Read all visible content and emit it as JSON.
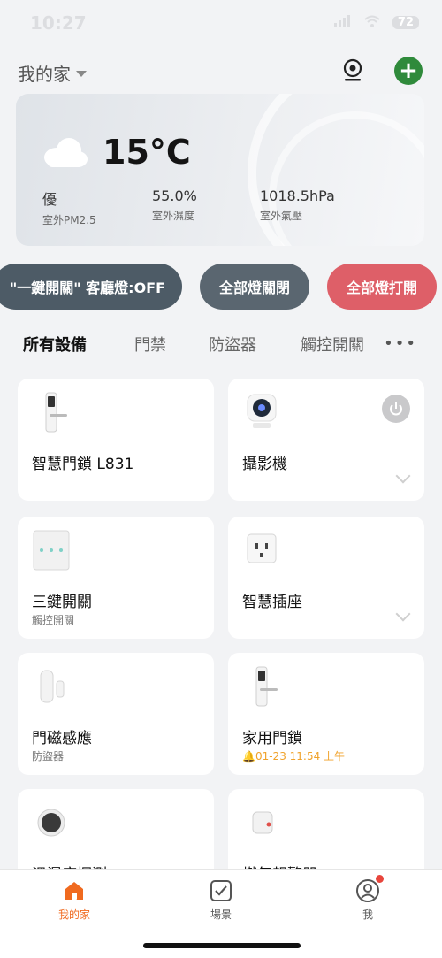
{
  "status_bar": {
    "time": "10:27",
    "battery": "72"
  },
  "header": {
    "home_name": "我的家"
  },
  "weather": {
    "temperature": "15°C",
    "stats": [
      {
        "value": "優",
        "label": "室外PM2.5"
      },
      {
        "value": "55.0%",
        "label": "室外濕度"
      },
      {
        "value": "1018.5hPa",
        "label": "室外氣壓"
      }
    ]
  },
  "scenes": [
    {
      "label": "\"一鍵開關\" 客廳燈:OFF"
    },
    {
      "label": "全部燈關閉"
    },
    {
      "label": "全部燈打開"
    }
  ],
  "tabs": [
    "所有設備",
    "門禁",
    "防盜器",
    "觸控開關"
  ],
  "devices": [
    {
      "name": "智慧門鎖 L831",
      "subtitle": ""
    },
    {
      "name": "攝影機",
      "subtitle": ""
    },
    {
      "name": "三鍵開關",
      "subtitle": "觸控開關"
    },
    {
      "name": "智慧插座",
      "subtitle": ""
    },
    {
      "name": "門磁感應",
      "subtitle": "防盜器"
    },
    {
      "name": "家用門鎖",
      "subtitle": "01-23 11:54 上午"
    },
    {
      "name": "溫濕度探測",
      "subtitle": ""
    },
    {
      "name": "燃氣報警器",
      "subtitle": ""
    }
  ],
  "bottom_nav": [
    {
      "label": "我的家"
    },
    {
      "label": "場景"
    },
    {
      "label": "我"
    }
  ],
  "colors": {
    "accent": "#f06a1f",
    "add_button": "#2f8a3b",
    "all_on": "#de5f68",
    "alert": "#f0a22a"
  }
}
